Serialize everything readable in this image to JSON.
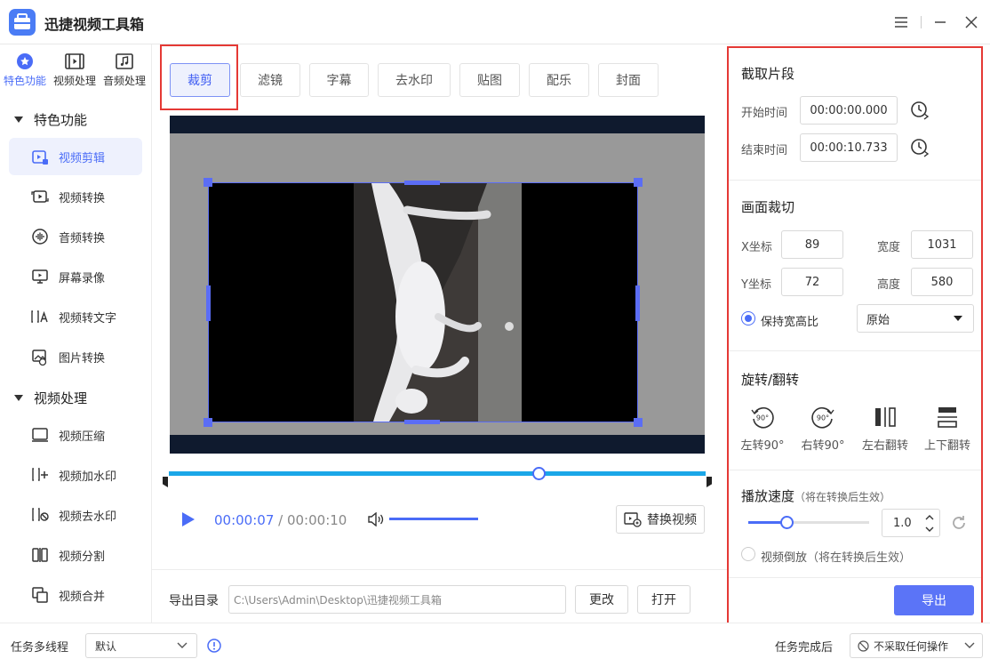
{
  "app": {
    "title": "迅捷视频工具箱"
  },
  "categories": [
    {
      "label": "特色功能",
      "icon": "star-icon"
    },
    {
      "label": "视频处理",
      "icon": "film-icon"
    },
    {
      "label": "音频处理",
      "icon": "music-icon"
    }
  ],
  "sidebar": {
    "group1": "特色功能",
    "group1_items": [
      {
        "label": "视频剪辑",
        "icon": "video-edit-icon"
      },
      {
        "label": "视频转换",
        "icon": "video-convert-icon"
      },
      {
        "label": "音频转换",
        "icon": "audio-wave-icon"
      },
      {
        "label": "屏幕录像",
        "icon": "screen-record-icon"
      },
      {
        "label": "视频转文字",
        "icon": "video-to-text-icon"
      },
      {
        "label": "图片转换",
        "icon": "image-convert-icon"
      }
    ],
    "group2": "视频处理",
    "group2_items": [
      {
        "label": "视频压缩",
        "icon": "compress-icon"
      },
      {
        "label": "视频加水印",
        "icon": "add-watermark-icon"
      },
      {
        "label": "视频去水印",
        "icon": "remove-watermark-icon"
      },
      {
        "label": "视频分割",
        "icon": "split-icon"
      },
      {
        "label": "视频合并",
        "icon": "merge-icon"
      }
    ]
  },
  "tabs": [
    "裁剪",
    "滤镜",
    "字幕",
    "去水印",
    "贴图",
    "配乐",
    "封面"
  ],
  "player": {
    "current_time": "00:00:07",
    "separator": " / ",
    "total_time": "00:00:10",
    "replace_label": "替换视频",
    "progress_fraction": 0.69,
    "volume_fraction": 1.0
  },
  "export": {
    "label": "导出目录",
    "path": "C:\\Users\\Admin\\Desktop\\迅捷视频工具箱",
    "change_label": "更改",
    "open_label": "打开"
  },
  "panel": {
    "clip_title": "截取片段",
    "start_label": "开始时间",
    "start_value": "00:00:00.000",
    "end_label": "结束时间",
    "end_value": "00:00:10.733",
    "crop_title": "画面裁切",
    "x_label": "X坐标",
    "x_value": "89",
    "width_label": "宽度",
    "width_value": "1031",
    "y_label": "Y坐标",
    "y_value": "72",
    "height_label": "高度",
    "height_value": "580",
    "keep_ratio_label": "保持宽高比",
    "ratio_value": "原始",
    "rotate_title": "旋转/翻转",
    "rotate_left": "左转90°",
    "rotate_right": "右转90°",
    "flip_h": "左右翻转",
    "flip_v": "上下翻转",
    "rotate_badge": "90°",
    "speed_title": "播放速度",
    "speed_note": "（将在转换后生效）",
    "speed_value": "1.0",
    "reverse_label": "视频倒放",
    "reverse_note": "（将在转换后生效）",
    "export_button": "导出"
  },
  "bottom": {
    "threads_label": "任务多线程",
    "threads_value": "默认",
    "after_label": "任务完成后",
    "after_value": "不采取任何操作"
  },
  "colors": {
    "accent": "#4a6cf7",
    "highlight_box": "#e53935",
    "timeline": "#1ba7e8"
  }
}
